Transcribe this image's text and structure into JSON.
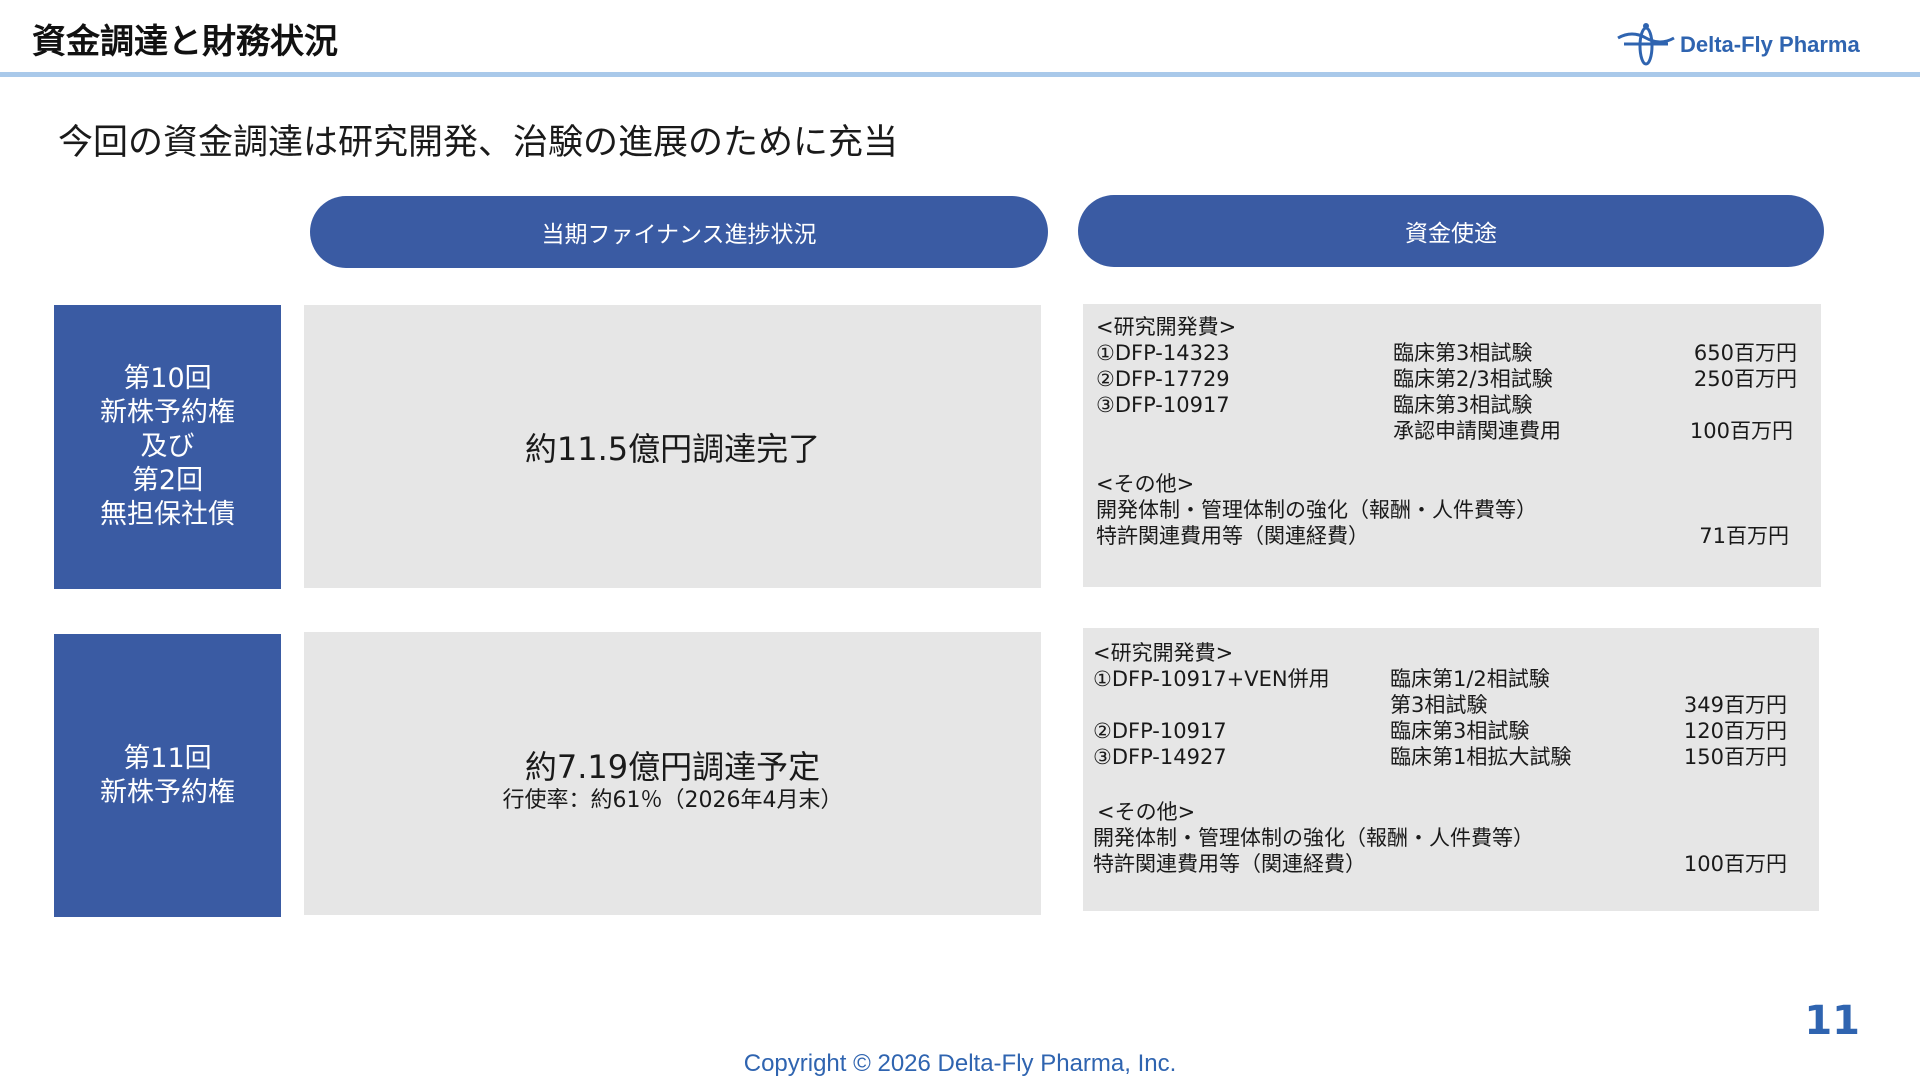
{
  "header": {
    "title": "資金調達と財務状況",
    "logo_text": "Delta-Fly Pharma",
    "accent_color": "#3a5ba3",
    "rule_color": "#a9c9ea"
  },
  "subtitle": "今回の資金調達は研究開発、治験の進展のために充当",
  "columns": {
    "left_header": "当期ファイナンス進捗状況",
    "right_header": "資金使途"
  },
  "rows": [
    {
      "label_lines": [
        "第10回",
        "新株予約権",
        "及び",
        "第2回",
        "無担保社債"
      ],
      "status_main": "約11.5億円調達完了",
      "uses": {
        "rd_header": "<研究開発費>",
        "items": [
          {
            "name": "①DFP-14323",
            "phase": "臨床第3相試験",
            "amount": "650百万円"
          },
          {
            "name": "②DFP-17729",
            "phase": "臨床第2/3相試験",
            "amount": "250百万円"
          },
          {
            "name": "③DFP-10917",
            "phase": "臨床第3相試験",
            "amount": ""
          },
          {
            "name": "",
            "phase": "承認申請関連費用",
            "amount": "100百万円"
          }
        ],
        "other_header": "<その他>",
        "other_line1": "開発体制・管理体制の強化（報酬・人件費等）",
        "other_line2": "特許関連費用等（関連経費）",
        "other_amount": "71百万円"
      }
    },
    {
      "label_lines": [
        "第11回",
        "新株予約権"
      ],
      "status_main": "約7.19億円調達予定",
      "status_sub": "行使率：約61％（2026年4月末）",
      "uses": {
        "rd_header": "<研究開発費>",
        "items": [
          {
            "name": "①DFP-10917+VEN併用",
            "phase": "臨床第1/2相試験",
            "amount": ""
          },
          {
            "name": "",
            "phase": "第3相試験",
            "amount": "349百万円"
          },
          {
            "name": "②DFP-10917",
            "phase": "臨床第3相試験",
            "amount": "120百万円"
          },
          {
            "name": "③DFP-14927",
            "phase": "臨床第1相拡大試験",
            "amount": "150百万円"
          }
        ],
        "other_header": "<その他>",
        "other_line1": "開発体制・管理体制の強化（報酬・人件費等）",
        "other_line2": "特許関連費用等（関連経費）",
        "other_amount": "100百万円"
      }
    }
  ],
  "page_number": "11",
  "copyright": "Copyright © 2026 Delta-Fly Pharma, Inc."
}
